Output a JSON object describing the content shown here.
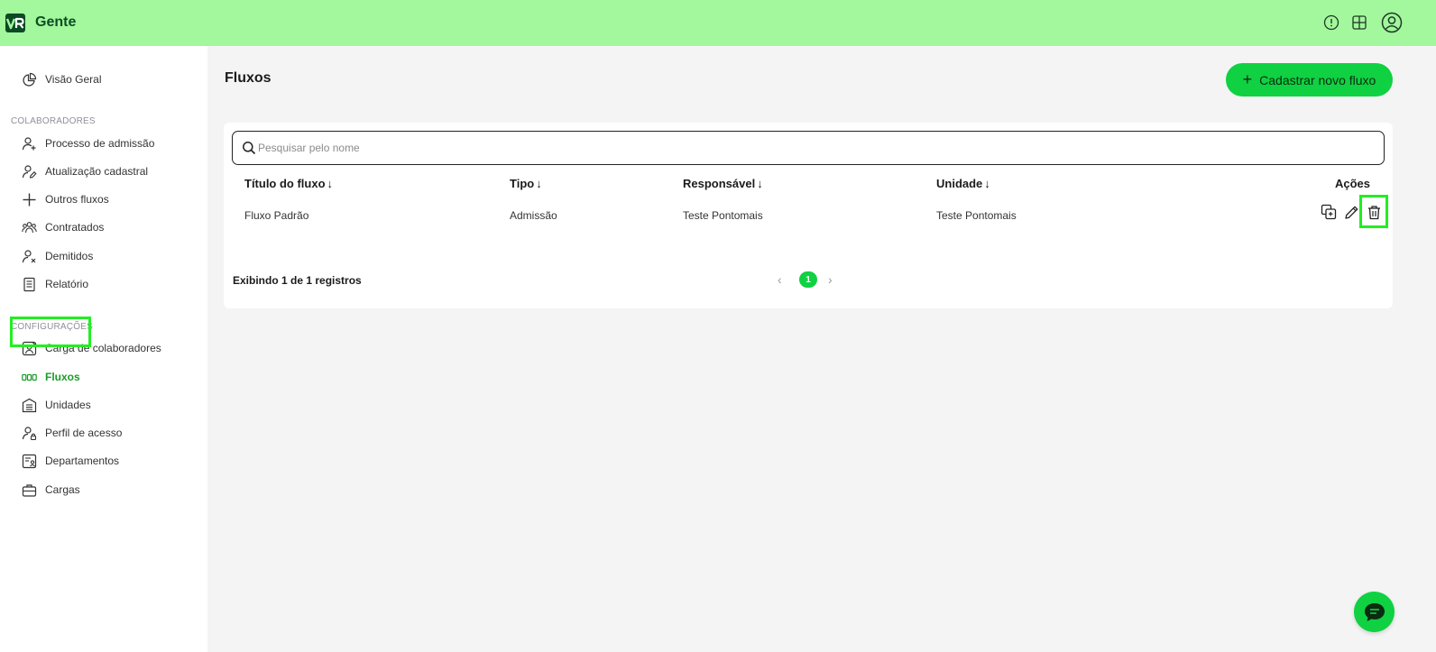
{
  "app": {
    "name": "Gente",
    "logo_text": "VR",
    "brand_color": "#0fd142",
    "topbar_color": "#a3f79c"
  },
  "topbar": {
    "icons": [
      "info-icon",
      "apps-grid-icon",
      "user-account-icon"
    ]
  },
  "sidebar": {
    "overview": {
      "label": "Visão Geral",
      "icon": "pie-chart-icon"
    },
    "sections": [
      {
        "title": "COLABORADORES",
        "items": [
          {
            "label": "Processo de admissão",
            "icon": "user-add-icon"
          },
          {
            "label": "Atualização cadastral",
            "icon": "user-edit-icon"
          },
          {
            "label": "Outros fluxos",
            "icon": "plus-icon"
          },
          {
            "label": "Contratados",
            "icon": "users-group-icon"
          },
          {
            "label": "Demitidos",
            "icon": "user-remove-icon"
          },
          {
            "label": "Relatório",
            "icon": "report-icon"
          }
        ]
      },
      {
        "title": "CONFIGURAÇÕES",
        "items": [
          {
            "label": "Carga de colaboradores",
            "icon": "upload-users-icon"
          },
          {
            "label": "Fluxos",
            "icon": "flow-icon",
            "active": true
          },
          {
            "label": "Unidades",
            "icon": "building-icon"
          },
          {
            "label": "Perfil de acesso",
            "icon": "user-lock-icon"
          },
          {
            "label": "Departamentos",
            "icon": "department-icon"
          },
          {
            "label": "Cargas",
            "icon": "briefcase-icon"
          }
        ]
      }
    ]
  },
  "main": {
    "title": "Fluxos",
    "new_button": "Cadastrar novo fluxo",
    "search": {
      "placeholder": "Pesquisar pelo nome",
      "value": ""
    },
    "table": {
      "columns": [
        {
          "label": "Título do fluxo",
          "sort": "↓"
        },
        {
          "label": "Tipo",
          "sort": "↓"
        },
        {
          "label": "Responsável",
          "sort": "↓"
        },
        {
          "label": "Unidade",
          "sort": "↓"
        },
        {
          "label": "Ações"
        }
      ],
      "rows": [
        {
          "title": "Fluxo Padrão",
          "type": "Admissão",
          "responsible": "Teste Pontomais",
          "unit": "Teste Pontomais",
          "actions": [
            "duplicate-icon",
            "edit-icon",
            "trash-icon"
          ]
        }
      ]
    },
    "footer": {
      "records_text": "Exibindo 1 de 1 registros",
      "current_page": "1",
      "prev": "‹",
      "next": "›"
    }
  }
}
